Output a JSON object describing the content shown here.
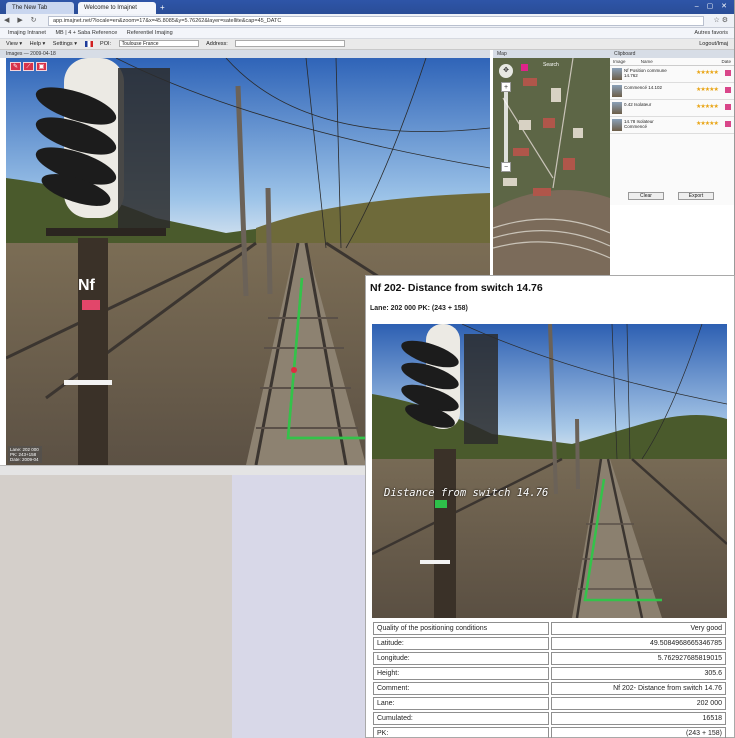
{
  "browser": {
    "tabs": [
      "The New Tab",
      "Welcome to Imajnet"
    ],
    "url": "app.imajnet.net/?locale=en&zoom=17&x=45.8085&y=5.76262&layer=satellite&cap=45_DATC",
    "bookmarks": [
      "Imajing Intranet",
      "MB | 4 + Saba Reference",
      "Referentiel Imajing"
    ],
    "bookmarks_right": "Autres favoris"
  },
  "app_menu": {
    "view": "View ▾",
    "help": "Help ▾",
    "settings": "Settings ▾",
    "poi_label": "POI:",
    "poi_value": "Toulouse France",
    "address_label": "Address:",
    "logout": "Logout/Imaj"
  },
  "panels": {
    "image_header": "Images — 2009-04-18",
    "map_header": "Map",
    "clipboard_header": "Clipboard",
    "map_search": "Search"
  },
  "main_photo": {
    "signal_label": "Nf",
    "info_lines": [
      "Lane: 202 000",
      "PK: 243+158",
      "Date: 2009-04"
    ]
  },
  "clipboard": {
    "columns": [
      "Image",
      "Name",
      "Date"
    ],
    "items": [
      {
        "name": "Nf Position commune 14.762",
        "stars": "★★★★★"
      },
      {
        "name": "Commencé 14.102",
        "stars": "★★★★★"
      },
      {
        "name": "0.42 Isolateur",
        "stars": "★★★★★"
      },
      {
        "name": "14.78 Isolateur Commencé",
        "stars": "★★★★★"
      }
    ],
    "buttons": [
      "Clear",
      "Export"
    ]
  },
  "report": {
    "title": "Nf 202- Distance from switch 14.76",
    "subtitle": "Lane: 202 000 PK: (243 + 158)",
    "overlay": "Distance from switch 14.76",
    "rows": [
      {
        "label": "Quality of the positioning conditions",
        "value": "Very good"
      },
      {
        "label": "Latitude:",
        "value": "49.5084968665346785"
      },
      {
        "label": "Longitude:",
        "value": "5.762927685819015"
      },
      {
        "label": "Height:",
        "value": "305.6"
      },
      {
        "label": "Comment:",
        "value": "Nf 202- Distance from switch 14.76"
      },
      {
        "label": "Lane:",
        "value": "202 000"
      },
      {
        "label": "Cumulated:",
        "value": "16518"
      },
      {
        "label": "PK:",
        "value": "(243 + 158)"
      }
    ]
  },
  "colors": {
    "accent": "#d8324a",
    "tab_bar": "#2e55a8",
    "highlight_line": "#34c24a"
  }
}
